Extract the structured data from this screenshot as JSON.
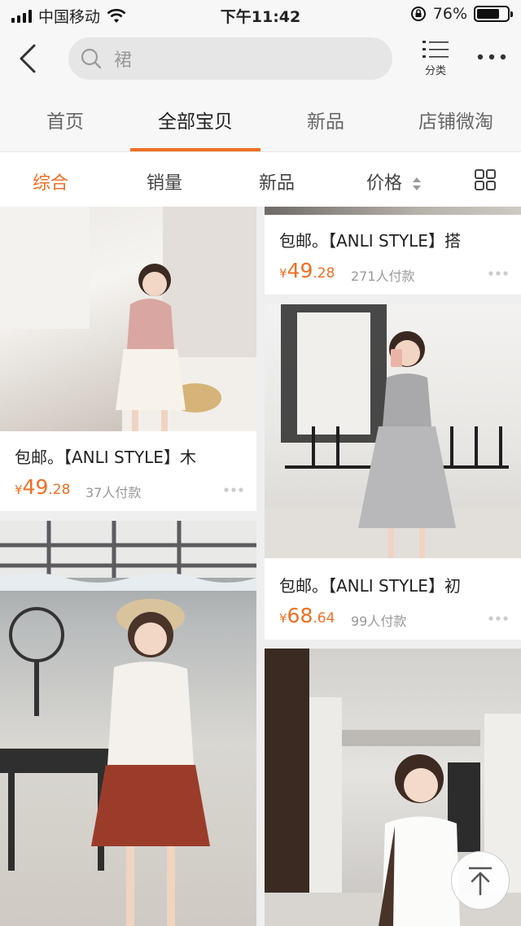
{
  "status_bar": {
    "carrier": "中国移动",
    "time": "下午11:42",
    "battery": "76%",
    "battery_level": 0.76
  },
  "search": {
    "query": "裙",
    "category_label": "分类"
  },
  "store_tabs": [
    {
      "label": "首页",
      "active": false
    },
    {
      "label": "全部宝贝",
      "active": true
    },
    {
      "label": "新品",
      "active": false
    },
    {
      "label": "店铺微淘",
      "active": false
    }
  ],
  "sort_bar": {
    "items": [
      {
        "label": "综合",
        "active": true
      },
      {
        "label": "销量",
        "active": false
      },
      {
        "label": "新品",
        "active": false
      },
      {
        "label": "价格",
        "active": false
      }
    ]
  },
  "products": [
    {
      "title": "包邮。【ANLI STYLE】搭",
      "price_currency": "¥",
      "price_int": "49",
      "price_dec": ".28",
      "buyers": "271人付款"
    },
    {
      "title": "包邮。【ANLI STYLE】木",
      "price_currency": "¥",
      "price_int": "49",
      "price_dec": ".28",
      "buyers": "37人付款"
    },
    {
      "title": "包邮。【ANLI STYLE】初",
      "price_currency": "¥",
      "price_int": "68",
      "price_dec": ".64",
      "buyers": "99人付款"
    },
    {
      "title": "",
      "price_currency": "",
      "price_int": "",
      "price_dec": "",
      "buyers": ""
    },
    {
      "title": "",
      "price_currency": "",
      "price_int": "",
      "price_dec": "",
      "buyers": ""
    }
  ],
  "colors": {
    "accent": "#f16f23",
    "background": "#efefef"
  }
}
